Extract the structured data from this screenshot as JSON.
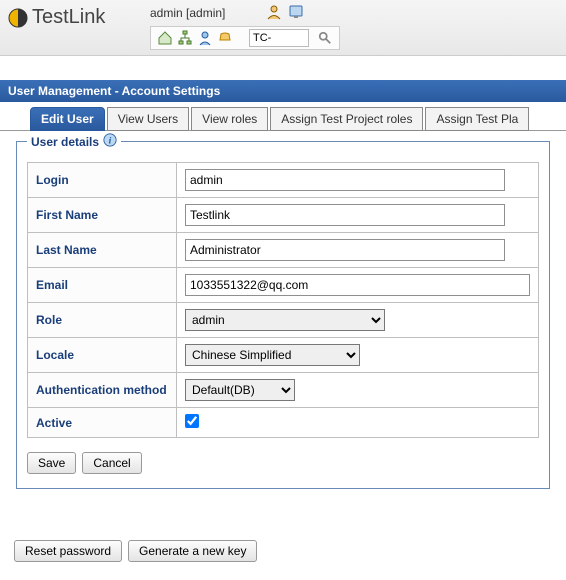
{
  "header": {
    "app_name": "TestLink",
    "user_label": "admin [admin]"
  },
  "toolbar": {
    "tc_value": "TC-"
  },
  "section_title": "User Management - Account Settings",
  "tabs": [
    {
      "label": "Edit User"
    },
    {
      "label": "View Users"
    },
    {
      "label": "View roles"
    },
    {
      "label": "Assign Test Project roles"
    },
    {
      "label": "Assign Test Pla"
    }
  ],
  "fieldset": {
    "legend": "User details",
    "fields": {
      "login_label": "Login",
      "login_value": "admin",
      "first_name_label": "First Name",
      "first_name_value": "Testlink",
      "last_name_label": "Last Name",
      "last_name_value": "Administrator",
      "email_label": "Email",
      "email_value": "1033551322@qq.com",
      "role_label": "Role",
      "role_value": "admin",
      "locale_label": "Locale",
      "locale_value": "Chinese Simplified",
      "auth_label": "Authentication method",
      "auth_value": "Default(DB)",
      "active_label": "Active",
      "active_checked": true
    }
  },
  "buttons": {
    "save": "Save",
    "cancel": "Cancel",
    "reset_password": "Reset password",
    "generate_key": "Generate a new key"
  }
}
